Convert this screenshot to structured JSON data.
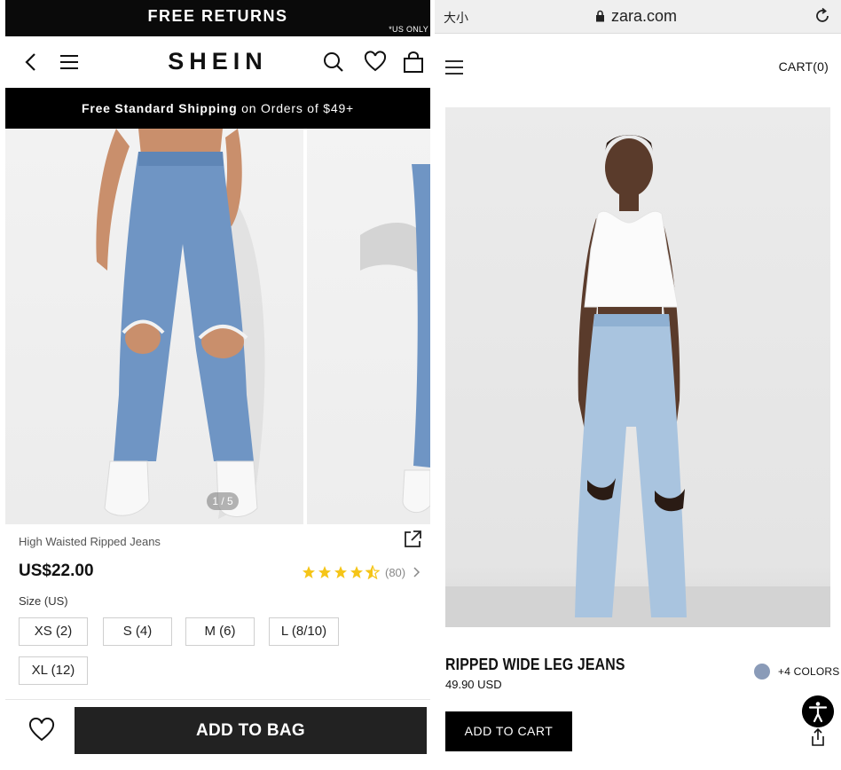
{
  "shein": {
    "promo_banner": {
      "text": "FREE RETURNS",
      "note": "*US ONLY"
    },
    "header": {
      "logo": "SHEIN",
      "icons": [
        "back-icon",
        "menu-icon",
        "search-icon",
        "heart-icon",
        "bag-icon"
      ]
    },
    "shipping_banner": {
      "bold": "Free Standard Shipping",
      "rest": " on Orders of $49+"
    },
    "gallery": {
      "counter": "1 / 5"
    },
    "product": {
      "name": "High Waisted Ripped Jeans",
      "price": "US$22.00",
      "rating": 4.5,
      "review_count": "(80)"
    },
    "size": {
      "label": "Size (US)",
      "options": [
        "XS (2)",
        "S (4)",
        "M (6)",
        "L (8/10)",
        "XL (12)"
      ]
    },
    "add_to_bag": "ADD TO BAG",
    "colors": {
      "star": "#f5c518",
      "button": "#222222",
      "banner": "#000000"
    }
  },
  "zara": {
    "browser": {
      "text_size": "大小",
      "host": "zara.com"
    },
    "cart": "CART(0)",
    "product": {
      "name": "RIPPED WIDE LEG JEANS",
      "price": "49.90 USD",
      "colors_more": "+4 COLORS",
      "swatch_color": "#8a9bb8"
    },
    "add_to_cart": "ADD TO CART"
  }
}
